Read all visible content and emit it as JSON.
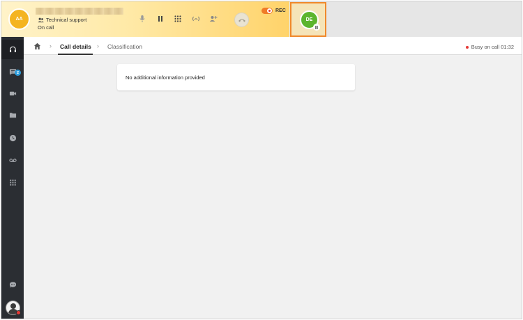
{
  "call": {
    "caller_initials": "AA",
    "queue_label": "Technical support",
    "status_label": "On call",
    "rec_label": "REC",
    "held_initials": "DE"
  },
  "controls": {
    "icons": [
      "microphone-icon",
      "pause-icon",
      "dialpad-icon",
      "transfer-icon",
      "add-participant-icon",
      "hangup-icon"
    ]
  },
  "sidebar": {
    "items": [
      {
        "icon": "headset-icon",
        "active": true
      },
      {
        "icon": "chat-icon",
        "badge": "2"
      },
      {
        "icon": "video-icon"
      },
      {
        "icon": "folder-icon"
      },
      {
        "icon": "history-icon"
      },
      {
        "icon": "voicemail-icon"
      },
      {
        "icon": "apps-grid-icon"
      }
    ],
    "bottom": [
      {
        "icon": "chat-bubble-icon"
      }
    ]
  },
  "tabs": {
    "items": [
      {
        "label": "Call details",
        "active": true
      },
      {
        "label": "Classification",
        "active": false
      }
    ],
    "busy_label": "Busy on call 01:32"
  },
  "content": {
    "card_message": "No additional information provided"
  },
  "colors": {
    "accent_orange": "#f0892b",
    "caller_avatar": "#f4b421",
    "held_avatar": "#5cb52e",
    "sidebar_bg": "#2b2e33",
    "badge_blue": "#2d9cdb",
    "status_red": "#e53935"
  }
}
